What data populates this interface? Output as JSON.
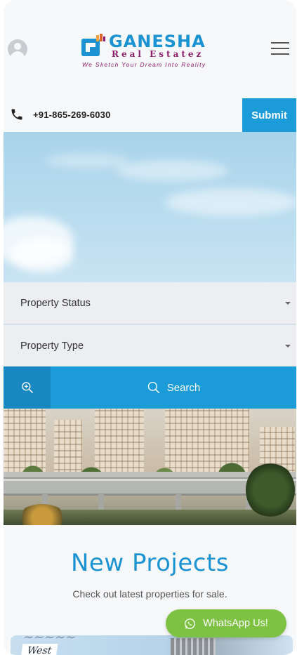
{
  "header": {
    "brand_name": "GANESHA",
    "brand_sub": "Real Estatez",
    "tagline": "We Sketch Your Dream Into Reality",
    "avatar_icon": "user-avatar-icon",
    "menu_icon": "hamburger-menu-icon"
  },
  "contact": {
    "phone": "+91-865-269-6030",
    "phone_icon": "phone-icon",
    "submit_label": "Submit"
  },
  "search_form": {
    "property_status": "Property Status",
    "property_type": "Property Type",
    "advanced_icon": "zoom-in-icon",
    "search_label": "Search"
  },
  "projects": {
    "title": "New Projects",
    "subtitle": "Check out latest properties for sale.",
    "card_label": "West"
  },
  "whatsapp": {
    "label": "WhatsApp Us!"
  },
  "colors": {
    "brand_blue": "#1b9bd8",
    "brand_purple": "#8e1c6c",
    "whatsapp_green": "#7dc242"
  }
}
